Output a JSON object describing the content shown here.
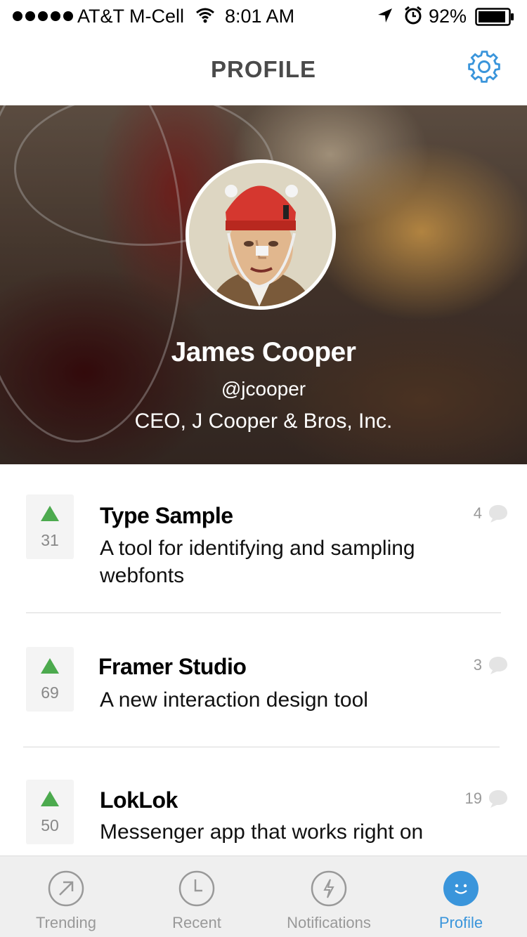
{
  "status_bar": {
    "carrier": "AT&T M-Cell",
    "time": "8:01 AM",
    "battery": "92%"
  },
  "header": {
    "title": "PROFILE"
  },
  "profile": {
    "name": "James Cooper",
    "handle": "@jcooper",
    "title": "CEO, J Cooper & Bros, Inc."
  },
  "posts": [
    {
      "votes": "31",
      "title": "Type Sample",
      "description": "A tool for identifying and sampling webfonts",
      "comments": "4"
    },
    {
      "votes": "69",
      "title": "Framer Studio",
      "description": "A new interaction design tool",
      "comments": "3"
    },
    {
      "votes": "50",
      "title": "LokLok",
      "description": "Messenger app that works right on",
      "comments": "19"
    }
  ],
  "tabs": [
    {
      "label": "Trending",
      "icon": "trending-arrow-icon"
    },
    {
      "label": "Recent",
      "icon": "clock-icon"
    },
    {
      "label": "Notifications",
      "icon": "lightning-icon"
    },
    {
      "label": "Profile",
      "icon": "smiley-icon",
      "active": true
    }
  ],
  "colors": {
    "accent": "#3a95db",
    "upvote": "#4caa4e",
    "title_gray": "#4a4a4a"
  }
}
